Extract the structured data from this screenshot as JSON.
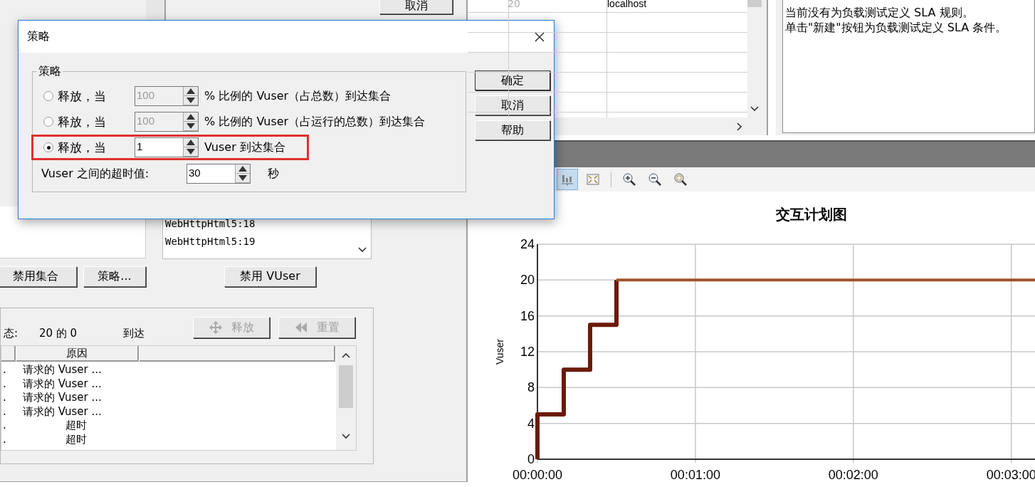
{
  "background_window": {
    "top_button": "取消",
    "script_list": {
      "items": [
        "WebHttpHtml5:18",
        "WebHttpHtml5:19"
      ]
    },
    "buttons": [
      "禁用集合",
      "策略...",
      "禁用 VUser"
    ],
    "status_group": {
      "status_label": "态:",
      "count": "20 的 0",
      "arrived": "到达",
      "buttons": [
        {
          "label": "释放",
          "kind": "release",
          "disabled": true
        },
        {
          "label": "重置",
          "kind": "reset",
          "disabled": true
        }
      ],
      "table": {
        "columns": [
          "原因"
        ],
        "rows": [
          {
            "column_1": ".",
            "reason": "请求的 Vuser ..."
          },
          {
            "column_1": ".",
            "reason": "请求的 Vuser ..."
          },
          {
            "column_1": ".",
            "reason": "请求的 Vuser ..."
          },
          {
            "column_1": ".",
            "reason": "请求的 Vuser ..."
          },
          {
            "column_1": ".",
            "reason": "超时"
          },
          {
            "column_1": ".",
            "reason": "超时"
          }
        ]
      }
    }
  },
  "host_table": {
    "rows": [
      {
        "column_1": "20",
        "column_2": "localhost",
        "disabled": true
      }
    ]
  },
  "sla_panel": {
    "lines": [
      "当前没有为负载测试定义 SLA 规则。",
      "单击\"新建\"按钮为负载测试定义 SLA 条件。"
    ]
  },
  "chart_panel": {
    "toolbar": [
      {
        "kind": "chart",
        "selected": true
      },
      {
        "kind": "fit",
        "selected": false
      },
      {
        "kind": "zoom-in",
        "selected": false
      },
      {
        "kind": "zoom-out",
        "selected": false
      },
      {
        "kind": "zoom-fit",
        "selected": false
      }
    ],
    "chart_data": {
      "type": "line",
      "title": "交互计划图",
      "ylabel": "Vuser",
      "x": [
        0,
        0,
        10,
        10,
        20,
        20,
        30,
        30,
        189
      ],
      "series": [
        {
          "color": "#6b1a08",
          "values": [
            0,
            5,
            5,
            10,
            10,
            15,
            15,
            20,
            null
          ]
        },
        {
          "color": "#a0522d",
          "values": [
            null,
            null,
            null,
            null,
            null,
            null,
            null,
            20,
            20
          ]
        }
      ],
      "grid": true,
      "xlim": [
        0,
        189
      ],
      "ylim": [
        0,
        24
      ],
      "xticks": [
        {
          "value": 0,
          "label": "00:00:00"
        },
        {
          "value": 60,
          "label": "00:01:00"
        },
        {
          "value": 120,
          "label": "00:02:00"
        },
        {
          "value": 180,
          "label": "00:03:00"
        }
      ],
      "yticks": [
        0,
        4,
        8,
        12,
        16,
        20,
        24
      ]
    }
  },
  "dialog": {
    "title": "策略",
    "group_title": "策略",
    "options": [
      {
        "selected": false,
        "label": "释放，当",
        "value": "100",
        "disabled": true,
        "suffix": "% 比例的 Vuser（占总数）到达集合",
        "highlighted": false
      },
      {
        "selected": false,
        "label": "释放，当",
        "value": "100",
        "disabled": true,
        "suffix": "% 比例的 Vuser（占运行的总数）到达集合",
        "highlighted": false
      },
      {
        "selected": true,
        "label": "释放，当",
        "value": "1",
        "disabled": false,
        "suffix": "Vuser 到达集合",
        "highlighted": true
      }
    ],
    "timeout": {
      "label": "Vuser 之间的超时值:",
      "value": "30",
      "unit": "秒"
    },
    "buttons": [
      {
        "label": "确定",
        "default": true
      },
      {
        "label": "取消",
        "default": false
      },
      {
        "label": "帮助",
        "default": false
      }
    ]
  }
}
